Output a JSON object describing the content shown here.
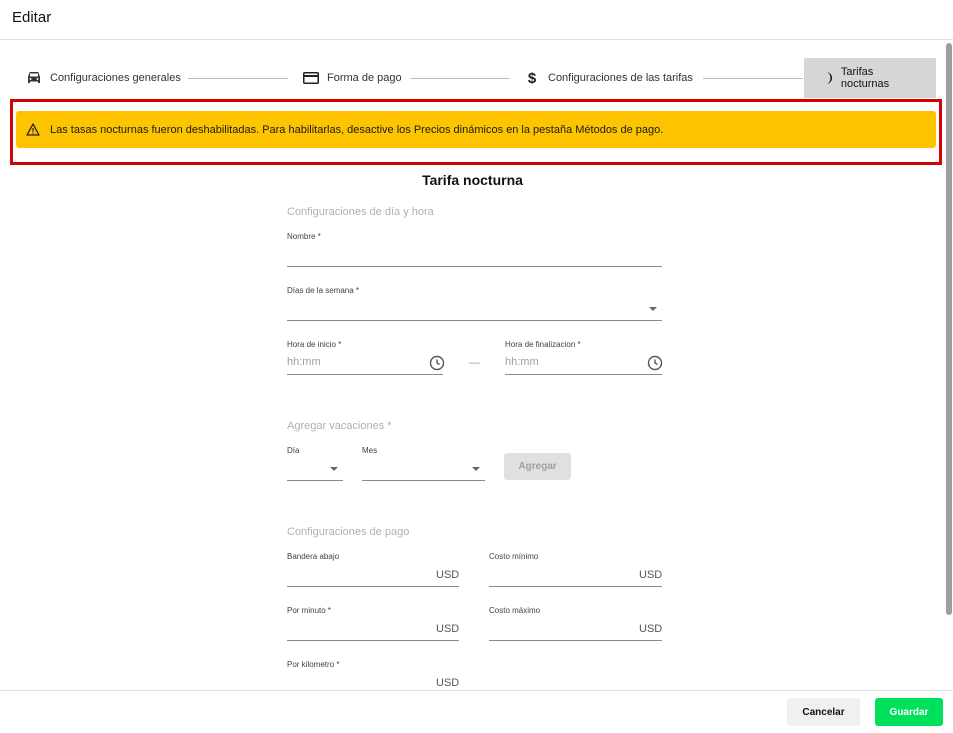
{
  "dialog": {
    "title": "Editar"
  },
  "stepper": {
    "steps": [
      {
        "label": "Configuraciones generales",
        "icon": "car-icon"
      },
      {
        "label": "Forma de pago",
        "icon": "credit-card-icon"
      },
      {
        "label": "Configuraciones de las tarifas",
        "icon": "dollar-icon"
      },
      {
        "label": "Tarifas nocturnas",
        "icon": "moon-icon",
        "active": true
      }
    ]
  },
  "alert": {
    "text": "Las tasas nocturnas fueron deshabilitadas. Para habilitarlas, desactive los Precios dinámicos en la pestaña Métodos de pago.",
    "icon": "warning-icon",
    "color": "#ffc400",
    "outline_color": "#d50000"
  },
  "form": {
    "title": "Tarifa nocturna",
    "schedule_section": {
      "title": "Configuraciones de día y hora",
      "name_label": "Nombre *",
      "name_value": "",
      "weekdays_label": "Días de la semana *",
      "weekdays_value": "",
      "start_label": "Hora de inicio *",
      "start_placeholder": "hh:mm",
      "separator": "—",
      "end_label": "Hora de finalizacion *",
      "end_placeholder": "hh:mm"
    },
    "holidays_section": {
      "title": "Agregar vacaciones *",
      "day_label": "Día",
      "day_value": "",
      "month_label": "Mes",
      "month_value": "",
      "add_button": "Agregar"
    },
    "payment_section": {
      "title": "Configuraciones de pago",
      "flag_down_label": "Bandera abajo",
      "min_cost_label": "Costo mínimo",
      "per_minute_label": "Por minuto *",
      "max_cost_label": "Costo máximo",
      "per_km_label": "Por kilometro *",
      "currency": "USD"
    }
  },
  "footer": {
    "cancel": "Cancelar",
    "save": "Guardar",
    "save_color": "#00e15b"
  }
}
